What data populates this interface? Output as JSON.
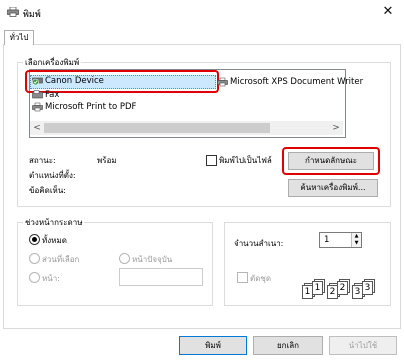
{
  "window": {
    "title": "พิมพ์",
    "icon": "printer-icon",
    "close_glyph": "✕"
  },
  "tabs": [
    {
      "label": "ทั่วไป",
      "selected": true
    }
  ],
  "select_printer": {
    "group_label": "เลือกเครื่องพิมพ์",
    "printers": [
      {
        "name": "Canon Device",
        "icon": "default-printer-icon",
        "selected": true
      },
      {
        "name": "Microsoft XPS Document Writer",
        "icon": "printer-icon"
      },
      {
        "name": "Fax",
        "icon": "fax-icon"
      },
      {
        "name": "Microsoft Print to PDF",
        "icon": "printer-icon"
      }
    ],
    "status_label": "สถานะ:",
    "status_value": "พร้อม",
    "location_label": "ตำแหน่งที่ตั้ง:",
    "comment_label": "ข้อคิดเห็น:",
    "print_to_file_label": "พิมพ์ไปเป็นไฟล์",
    "print_to_file_checked": false,
    "preferences_button": "กำหนดลักษณะ",
    "find_printer_button": "ค้นหาเครื่องพิมพ์..."
  },
  "page_range": {
    "group_label": "ช่วงหน้ากระดาษ",
    "all_label": "ทั้งหมด",
    "selection_label": "ส่วนที่เลือก",
    "current_page_label": "หน้าปัจจุบัน",
    "pages_label": "หน้า:",
    "pages_value": "",
    "selected_option": "all"
  },
  "copies": {
    "label": "จำนวนสำเนา:",
    "value": "1",
    "collate_label": "ตัดชุด",
    "collate_checked": false,
    "collate_pages": [
      "1",
      "1",
      "2",
      "2",
      "3",
      "3"
    ]
  },
  "buttons": {
    "print": "พิมพ์",
    "cancel": "ยกเลิก",
    "apply": "นำไปใช้"
  },
  "colors": {
    "highlight": "#cce8ff",
    "highlight_border": "#99d1ff",
    "callout_red": "#e00000"
  }
}
